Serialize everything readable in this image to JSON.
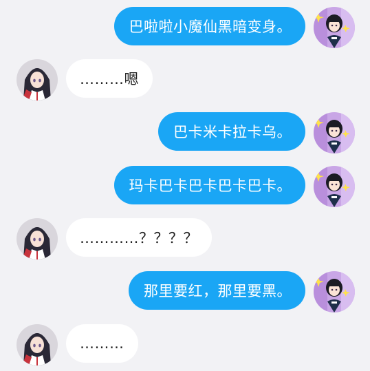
{
  "chat": {
    "messages": [
      {
        "side": "right",
        "text": "巴啦啦小魔仙黑暗变身。"
      },
      {
        "side": "left",
        "text": "………嗯"
      },
      {
        "side": "right",
        "text": "巴卡米卡拉卡乌。"
      },
      {
        "side": "right",
        "text": "玛卡巴卡巴卡巴卡巴卡。"
      },
      {
        "side": "left",
        "text": "…………？？？？"
      },
      {
        "side": "right",
        "text": "那里要红，那里要黑。"
      },
      {
        "side": "left",
        "text": "………"
      }
    ]
  },
  "colors": {
    "background": "#f2f2f5",
    "outgoing_bubble": "#1aa6f5",
    "incoming_bubble": "#ffffff"
  },
  "icons": {
    "outgoing_avatar": "girl-avatar-purple-plaid",
    "incoming_avatar": "girl-avatar-bunny"
  }
}
